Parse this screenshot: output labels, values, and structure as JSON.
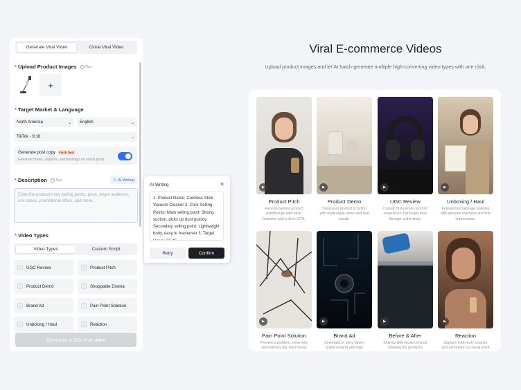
{
  "left_panel": {
    "tabs": [
      "Generate Viral Video",
      "Clone Viral Video"
    ],
    "upload_title": "Upload Product Images",
    "tips": "Tips",
    "add_symbol": "+",
    "target_title": "Target Market & Language",
    "market_value": "North America",
    "language_value": "English",
    "platform_value": "TikTok - 9:16",
    "post_copy_title": "Generate post copy",
    "flash_badge": "Flash Deal",
    "post_copy_desc": "Generate hooks, captions, and hashtags for social posts.",
    "post_copy_enabled": true,
    "description_title": "Description",
    "ai_writing_chip": "AI Writing",
    "description_placeholder": "Enter the product's key selling points, price, target audience, use cases, promotional offers, and more...",
    "video_types_title": "Video Types",
    "video_type_tabs": [
      "Video Types",
      "Custom Script"
    ],
    "options": [
      "UGC Review",
      "Product Pitch",
      "Product Demo",
      "Shoppable Drama",
      "Brand Ad",
      "Pain Point Solution",
      "Unboxing / Haul",
      "Reaction"
    ],
    "generate_button": "Generate a 15s viral video"
  },
  "popup": {
    "title": "AI Writing",
    "text": "1. Product Name: Cordless Stick Vacuum Cleaner 2. Core Selling Points: Main selling point: Strong suction, picks up dust quickly Secondary selling point: Lightweight body, easy to maneuver 3. Target Users: 25-45",
    "retry": "Retry",
    "confirm": "Confirm"
  },
  "header": {
    "title": "Viral E-commerce Videos",
    "subtitle": "Upload product images and let AI batch-generate multiple high-converting video types with one click."
  },
  "cards": [
    {
      "title": "Product Pitch",
      "desc": "Face-to-camera product walkthrough with price, features, and a direct CTA."
    },
    {
      "title": "Product Demo",
      "desc": "Show your product in action with multi-angle views and real results."
    },
    {
      "title": "UGC Review",
      "desc": "Casual, first-person product experience that builds trust through authenticity."
    },
    {
      "title": "Unboxing / Haul",
      "desc": "First-person package opening with genuine reactions and first impressions."
    },
    {
      "title": "Pain Point Solution",
      "desc": "Present a problem, show why old methods fail, then reveal"
    },
    {
      "title": "Brand Ad",
      "desc": "Cinematic or story-driven brand content with high"
    },
    {
      "title": "Before & After",
      "desc": "Side-by-side visual contrast showing the product's"
    },
    {
      "title": "Reaction",
      "desc": "Capture third-party surprise and admiration as social proof"
    }
  ]
}
